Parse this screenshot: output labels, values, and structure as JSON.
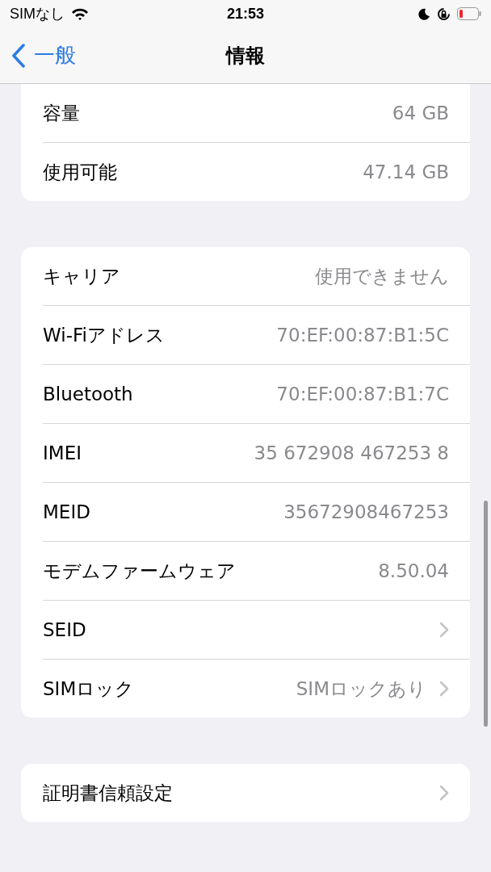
{
  "status_bar": {
    "carrier": "SIMなし",
    "time": "21:53"
  },
  "nav_bar": {
    "back": "一般",
    "title": "情報"
  },
  "groups": [
    {
      "rows": [
        {
          "label": "容量",
          "value": "64 GB",
          "chevron": false
        },
        {
          "label": "使用可能",
          "value": "47.14 GB",
          "chevron": false
        }
      ]
    },
    {
      "rows": [
        {
          "label": "キャリア",
          "value": "使用できません",
          "chevron": false
        },
        {
          "label": "Wi-Fiアドレス",
          "value": "70:EF:00:87:B1:5C",
          "chevron": false
        },
        {
          "label": "Bluetooth",
          "value": "70:EF:00:87:B1:7C",
          "chevron": false
        },
        {
          "label": "IMEI",
          "value": "35 672908 467253 8",
          "chevron": false
        },
        {
          "label": "MEID",
          "value": "35672908467253",
          "chevron": false
        },
        {
          "label": "モデムファームウェア",
          "value": "8.50.04",
          "chevron": false
        },
        {
          "label": "SEID",
          "chevron": true
        },
        {
          "label": "SIMロック",
          "value": "SIMロックあり",
          "chevron": true
        }
      ]
    },
    {
      "rows": [
        {
          "label": "証明書信頼設定",
          "chevron": true
        }
      ]
    }
  ]
}
